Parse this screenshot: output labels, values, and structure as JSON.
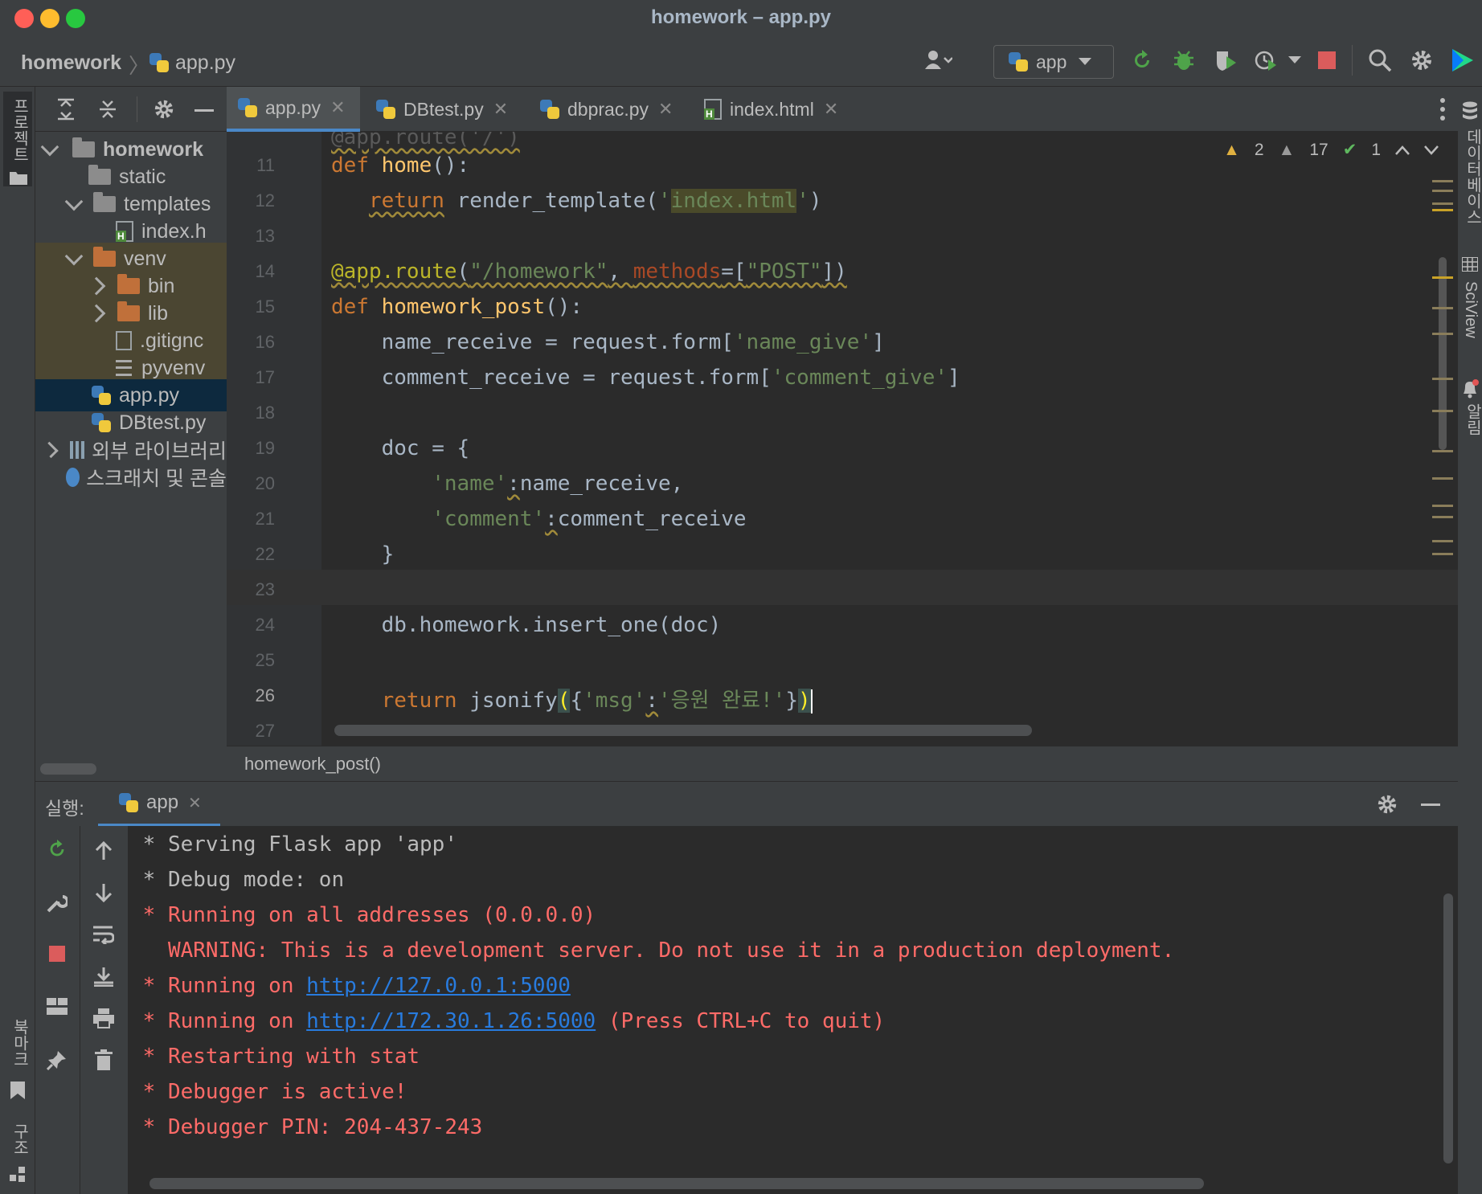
{
  "window": {
    "title": "homework – app.py"
  },
  "nav": {
    "project": "homework",
    "file": "app.py",
    "run_config": "app"
  },
  "left_strip": {
    "project_label": "프로젝트",
    "bookmarks_label": "북마크",
    "structure_label": "구조"
  },
  "right_strip": {
    "database_label": "데이터베이스",
    "sciview_label": "SciView",
    "notifications_label": "알림"
  },
  "project_tree": [
    {
      "label": "homework",
      "bold": true
    },
    {
      "label": "static"
    },
    {
      "label": "templates"
    },
    {
      "label": "index.h"
    },
    {
      "label": "venv"
    },
    {
      "label": "bin"
    },
    {
      "label": "lib"
    },
    {
      "label": ".gitignc"
    },
    {
      "label": "pyvenv"
    },
    {
      "label": "app.py"
    },
    {
      "label": "DBtest.py"
    },
    {
      "label": "외부 라이브러리"
    },
    {
      "label": "스크래치 및 콘솔"
    }
  ],
  "tabs": [
    {
      "label": "app.py",
      "active": true
    },
    {
      "label": "DBtest.py"
    },
    {
      "label": "dbprac.py"
    },
    {
      "label": "index.html"
    }
  ],
  "inspections": {
    "warnings": "2",
    "weak_warnings": "17",
    "ok": "1"
  },
  "editor": {
    "line_numbers": [
      "11",
      "12",
      "13",
      "14",
      "15",
      "16",
      "17",
      "18",
      "19",
      "20",
      "21",
      "22",
      "23",
      "24",
      "25",
      "26",
      "27"
    ],
    "current_line": "26"
  },
  "code_breadcrumb": "homework_post()",
  "run": {
    "label": "실행:",
    "tab": "app",
    "console": [
      " * Serving Flask app 'app'",
      " * Debug mode: on",
      " * Running on all addresses (0.0.0.0)",
      "   WARNING: This is a development server. Do not use it in a production deployment.",
      " * Running on ",
      "http://127.0.0.1:5000",
      " * Running on ",
      "http://172.30.1.26:5000",
      " (Press CTRL+C to quit)",
      " * Restarting with stat",
      " * Debugger is active!",
      " * Debugger PIN: 204-437-243"
    ]
  },
  "colors": {
    "background": "#2b2b2b",
    "panel": "#3c3f41",
    "selection": "#0d293e",
    "keyword": "#cc7832",
    "string": "#6a8759",
    "function": "#ffc66d",
    "console_error": "#ff6b68",
    "link": "#287bde"
  }
}
